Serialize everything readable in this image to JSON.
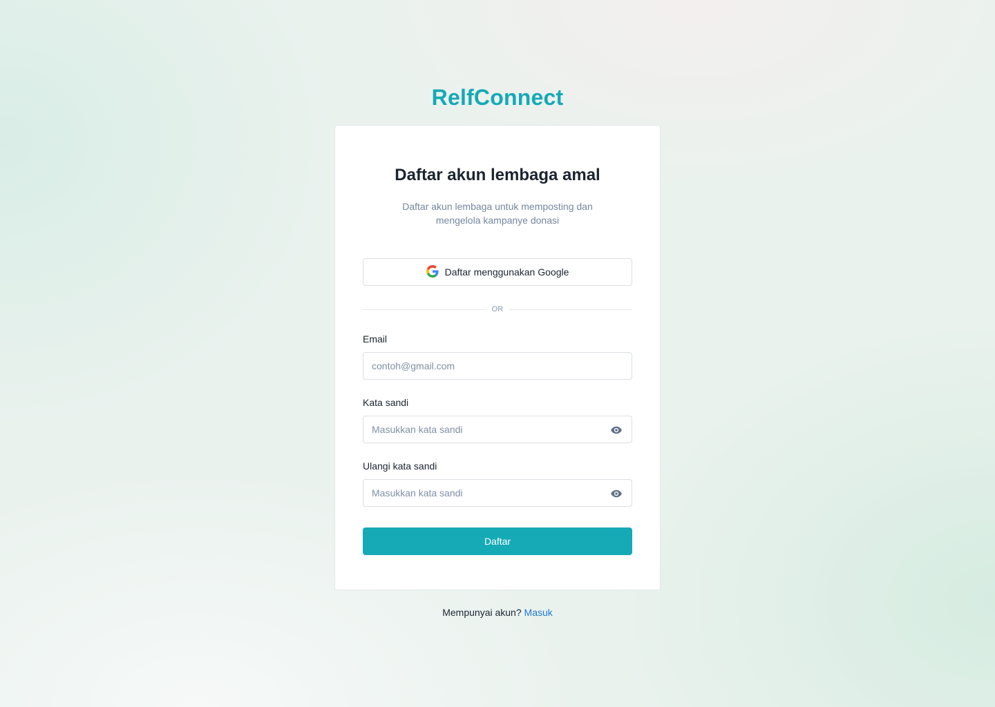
{
  "brand": {
    "name": "RelfConnect",
    "color": "#16a9b6"
  },
  "card": {
    "title": "Daftar akun lembaga amal",
    "subtitle": "Daftar akun lembaga untuk memposting dan mengelola kampanye donasi",
    "google_button": {
      "label": "Daftar menggunakan Google",
      "icon": "google-icon"
    },
    "divider_text": "OR",
    "fields": {
      "email": {
        "label": "Email",
        "placeholder": "contoh@gmail.com",
        "value": ""
      },
      "password": {
        "label": "Kata sandi",
        "placeholder": "Masukkan kata sandi",
        "value": "",
        "icon": "eye-icon"
      },
      "confirm_password": {
        "label": "Ulangi kata sandi",
        "placeholder": "Masukkan kata sandi",
        "value": "",
        "icon": "eye-icon"
      }
    },
    "submit_label": "Daftar",
    "accent_color": "#16aab7"
  },
  "footer": {
    "prompt": "Mempunyai akun?",
    "link_label": "Masuk",
    "link_color": "#1f78d1"
  }
}
